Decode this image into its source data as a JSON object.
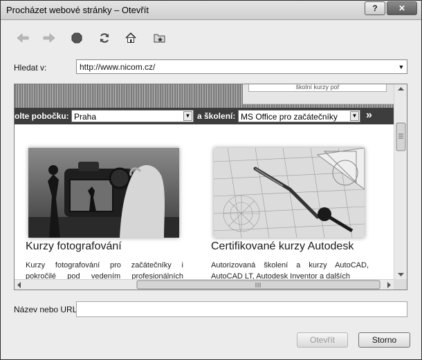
{
  "dialog": {
    "title": "Procházet webové stránky – Otevřít",
    "help_label": "?",
    "close_label": "✕"
  },
  "toolbar": {
    "back": "back-arrow-icon",
    "forward": "forward-arrow-icon",
    "stop": "stop-icon",
    "refresh": "refresh-icon",
    "home": "home-icon",
    "favorites": "favorites-folder-icon"
  },
  "search": {
    "label": "Hledat v:",
    "value": "http://www.nicom.cz/"
  },
  "web": {
    "banner_text": "školní kurzy poř",
    "branch_label": "olte pobočku:",
    "branch_value": "Praha",
    "training_label": "a školení:",
    "training_value": "MS Office pro začátečníky",
    "go": "»",
    "cards": [
      {
        "title": "Kurzy fotografování",
        "text": "Kurzy fotografování pro začátečníky i pokročilé pod vedením profesionálních fotografů."
      },
      {
        "title": "Certifikované kurzy Autodesk",
        "text": "Autorizovaná školení a kurzy AutoCAD, AutoCAD LT, Autodesk Inventor a dalších"
      }
    ]
  },
  "url": {
    "label": "Název nebo URL:",
    "value": ""
  },
  "buttons": {
    "open": "Otevřít",
    "cancel": "Storno"
  }
}
